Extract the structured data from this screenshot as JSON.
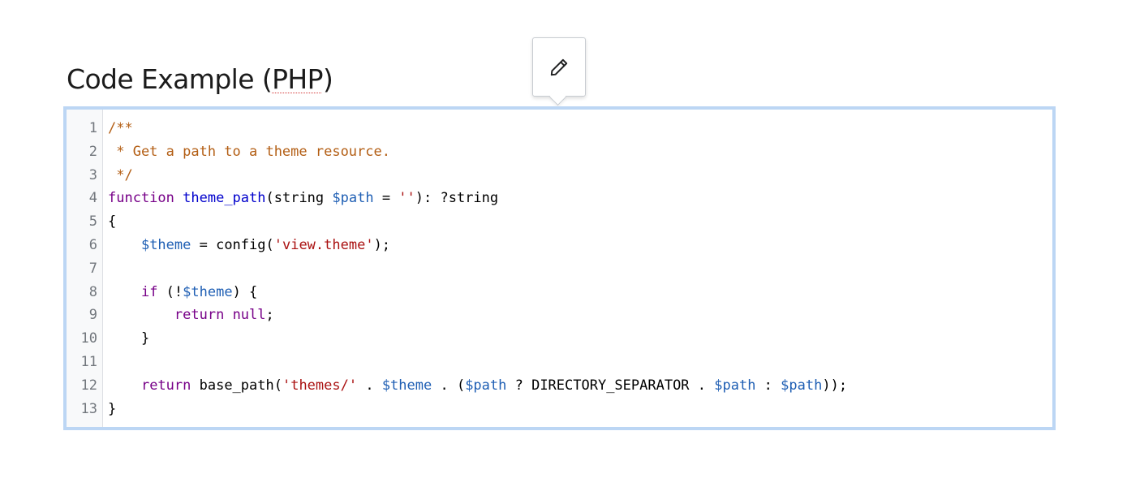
{
  "heading": {
    "prefix": "Code Example (",
    "abbr": "PHP",
    "suffix": ")"
  },
  "edit_popover": {
    "icon": "pencil-icon"
  },
  "code": {
    "language": "PHP",
    "line_numbers": [
      "1",
      "2",
      "3",
      "4",
      "5",
      "6",
      "7",
      "8",
      "9",
      "10",
      "11",
      "12",
      "13"
    ],
    "lines": [
      [
        {
          "t": "comment",
          "v": "/**"
        }
      ],
      [
        {
          "t": "comment",
          "v": " * Get a path to a theme resource."
        }
      ],
      [
        {
          "t": "comment",
          "v": " */"
        }
      ],
      [
        {
          "t": "keyword",
          "v": "function"
        },
        {
          "t": "plain",
          "v": " "
        },
        {
          "t": "func",
          "v": "theme_path"
        },
        {
          "t": "plain",
          "v": "(string "
        },
        {
          "t": "var",
          "v": "$path"
        },
        {
          "t": "plain",
          "v": " = "
        },
        {
          "t": "string",
          "v": "''"
        },
        {
          "t": "plain",
          "v": "): ?string"
        }
      ],
      [
        {
          "t": "plain",
          "v": "{"
        }
      ],
      [
        {
          "t": "plain",
          "v": "    "
        },
        {
          "t": "var",
          "v": "$theme"
        },
        {
          "t": "plain",
          "v": " = config("
        },
        {
          "t": "string",
          "v": "'view.theme'"
        },
        {
          "t": "plain",
          "v": ");"
        }
      ],
      [
        {
          "t": "plain",
          "v": ""
        }
      ],
      [
        {
          "t": "plain",
          "v": "    "
        },
        {
          "t": "keyword",
          "v": "if"
        },
        {
          "t": "plain",
          "v": " (!"
        },
        {
          "t": "var",
          "v": "$theme"
        },
        {
          "t": "plain",
          "v": ") {"
        }
      ],
      [
        {
          "t": "plain",
          "v": "        "
        },
        {
          "t": "keyword",
          "v": "return"
        },
        {
          "t": "plain",
          "v": " "
        },
        {
          "t": "keyword",
          "v": "null"
        },
        {
          "t": "plain",
          "v": ";"
        }
      ],
      [
        {
          "t": "plain",
          "v": "    }"
        }
      ],
      [
        {
          "t": "plain",
          "v": ""
        }
      ],
      [
        {
          "t": "plain",
          "v": "    "
        },
        {
          "t": "keyword",
          "v": "return"
        },
        {
          "t": "plain",
          "v": " base_path("
        },
        {
          "t": "string",
          "v": "'themes/'"
        },
        {
          "t": "plain",
          "v": " . "
        },
        {
          "t": "var",
          "v": "$theme"
        },
        {
          "t": "plain",
          "v": " . ("
        },
        {
          "t": "var",
          "v": "$path"
        },
        {
          "t": "plain",
          "v": " ? DIRECTORY_SEPARATOR . "
        },
        {
          "t": "var",
          "v": "$path"
        },
        {
          "t": "plain",
          "v": " : "
        },
        {
          "t": "var",
          "v": "$path"
        },
        {
          "t": "plain",
          "v": "));"
        }
      ],
      [
        {
          "t": "plain",
          "v": "}"
        }
      ]
    ]
  },
  "colors": {
    "frame_border": "#bcd6f4",
    "comment": "#b35e14",
    "keyword": "#770088",
    "function": "#0000cc",
    "variable": "#1f5fb4",
    "string": "#aa1111"
  }
}
